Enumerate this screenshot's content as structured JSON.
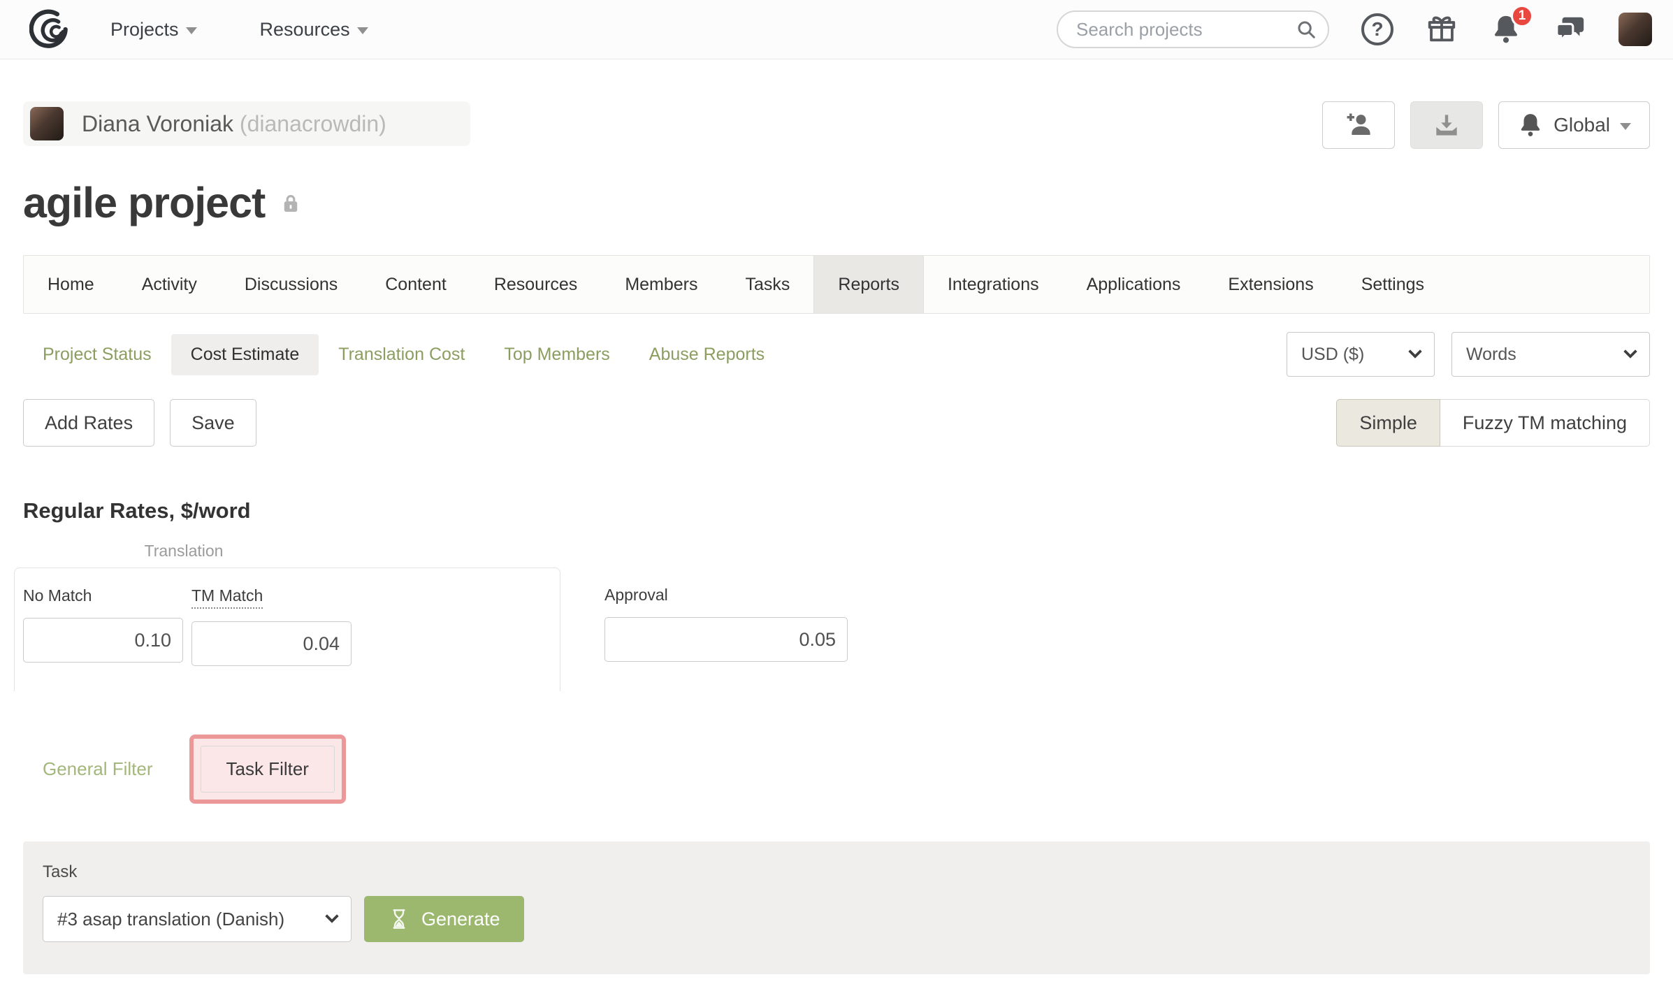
{
  "navbar": {
    "projects_label": "Projects",
    "resources_label": "Resources",
    "search_placeholder": "Search projects",
    "help_icon_glyph": "?",
    "notification_count": "1"
  },
  "user_header": {
    "name": "Diana Voroniak",
    "username": "(dianacrowdin)",
    "global_label": "Global"
  },
  "page": {
    "title": "agile project"
  },
  "tabs": {
    "items": [
      "Home",
      "Activity",
      "Discussions",
      "Content",
      "Resources",
      "Members",
      "Tasks",
      "Reports",
      "Integrations",
      "Applications",
      "Extensions",
      "Settings"
    ],
    "active": "Reports"
  },
  "subtabs": {
    "items": [
      "Project Status",
      "Cost Estimate",
      "Translation Cost",
      "Top Members",
      "Abuse Reports"
    ],
    "active": "Cost Estimate",
    "currency_value": "USD ($)",
    "unit_value": "Words"
  },
  "toolbar": {
    "add_rates_label": "Add Rates",
    "save_label": "Save",
    "mode_simple_label": "Simple",
    "mode_fuzzy_label": "Fuzzy TM matching"
  },
  "rates": {
    "heading": "Regular Rates, $/word",
    "group_caption": "Translation",
    "no_match_label": "No Match",
    "no_match_value": "0.10",
    "tm_match_label": "TM Match",
    "tm_match_value": "0.04",
    "approval_label": "Approval",
    "approval_value": "0.05"
  },
  "filters": {
    "general_label": "General Filter",
    "task_label": "Task Filter"
  },
  "task_panel": {
    "label": "Task",
    "selected_task": "#3 asap translation (Danish)",
    "generate_label": "Generate"
  },
  "colors": {
    "link_green": "#8b9e60",
    "generate_green": "#9cb86f",
    "highlight_red": "#ec9898",
    "badge_red": "#e8483f",
    "active_tab_gray": "#e9e8e4",
    "simple_toggle_beige": "#eae8df"
  }
}
